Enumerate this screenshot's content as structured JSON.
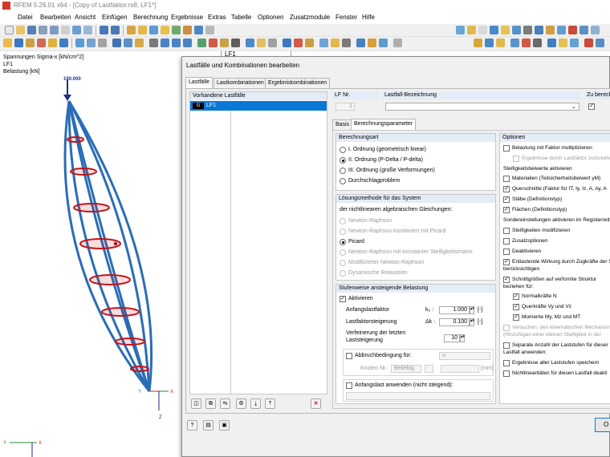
{
  "titlebar": {
    "text": "RFEM 5.26.01 x64 - [Copy of Lastfaktor.rs8, LF1*]"
  },
  "menu": [
    "Datei",
    "Bearbeiten",
    "Ansicht",
    "Einfügen",
    "Berechnung",
    "Ergebnisse",
    "Extras",
    "Tabelle",
    "Optionen",
    "Zusatzmodule",
    "Fenster",
    "Hilfe"
  ],
  "toolbar": {
    "load_case_combo": "LF1"
  },
  "workspace": {
    "info_lines": [
      "Spannungen Sigma-x [kN/cm^2]",
      "LF1",
      "Belastung [kN]"
    ],
    "load_value": "100.000",
    "axis_y": "Y",
    "axis_x": "X",
    "axis_z": "Z"
  },
  "dialog": {
    "title": "Lastfälle und Kombinationen bearbeiten",
    "tabs": [
      "Lastfälle",
      "Lastkombinationen",
      "Ergebniskombinationen"
    ],
    "list_header": "Vorhandene Lastfälle",
    "list_item_code": "G",
    "list_item": "LF1",
    "lf_nr_label": "LF Nr.",
    "lf_nr_value": "1",
    "lf_name_label": "Lastfall-Bezeichnung",
    "lf_name_value": "",
    "zu_label": "Zu berech",
    "subtabs": [
      "Basis",
      "Berechnungsparameter"
    ],
    "berechnungsart": {
      "header": "Berechnungsart",
      "options": [
        "I. Ordnung (geometrisch linear)",
        "II. Ordnung (P-Delta / P-delta)",
        "III. Ordnung (große Verformungen)",
        "Durchschlagproblem"
      ],
      "selected": 1
    },
    "loesung": {
      "header": "Lösungsmethode für das System",
      "subtitle": "der nichtlinearen algebraischen Gleichungen:",
      "options": [
        "Newton-Raphson",
        "Newton-Raphson kombiniert mit Picard",
        "Picard",
        "Newton-Raphson mit konstanter Steifigkeitsmatrix",
        "Modifizierter Newton-Raphson",
        "Dynamische Relaxation"
      ],
      "selected": 2
    },
    "stufen": {
      "header": "Stufenweise ansteigende Belastung",
      "aktivieren": "Aktivieren",
      "anfang_label": "Anfangslastfaktor",
      "anfang_sym": "k₀ :",
      "anfang_value": "1.000",
      "anfang_unit": "[-]",
      "steig_label": "Lastfaktorsteigerung",
      "steig_sym": "Δk :",
      "steig_value": "0.100",
      "steig_unit": "[-]",
      "verf_label_1": "Verfeinerung der letzten",
      "verf_label_2": "Laststeigerung",
      "verf_value": "10",
      "abbruch_label": "Abbruchbedingung für:",
      "abbruch_value": "u",
      "knoten_label": "Knoten Nr.:",
      "knoten_value": "Beliebig",
      "mm_unit": "[mm]",
      "anfangslast_label": "Anfangslast anwenden (nicht steigend):"
    },
    "optionen": {
      "header": "Optionen",
      "lines": [
        {
          "text": "Belastung mit Faktor multiplizieren:",
          "check": "off",
          "indent": 0
        },
        {
          "text": "Ergebnisse durch Lastfaktor zurückdividi",
          "check": "dis",
          "indent": 1
        },
        {
          "text": "Steifigkeitsbeiwerte aktivieren",
          "check": "none",
          "indent": 0
        },
        {
          "text": "Materialien (Teilsicherheitsbeiwert γM)",
          "check": "off",
          "indent": 0
        },
        {
          "text": "Querschnitte (Faktor für IT, Iy, Iz, A, Ay, A",
          "check": "on",
          "indent": 0
        },
        {
          "text": "Stäbe (Definitionstyp)",
          "check": "on",
          "indent": 0
        },
        {
          "text": "Flächen (Definitionstyp)",
          "check": "on",
          "indent": 0
        },
        {
          "text": "Sondereinstellungen aktivieren im Registerreit",
          "check": "none",
          "indent": 0
        },
        {
          "text": "Steifigkeiten modifizieren",
          "check": "off",
          "indent": 0
        },
        {
          "text": "Zusatzoptionen",
          "check": "off",
          "indent": 0
        },
        {
          "text": "Deaktivieren",
          "check": "off",
          "indent": 0
        },
        {
          "text": "Entlastende Wirkung durch Zugkräfte der S",
          "check": "on",
          "indent": 0
        },
        {
          "text": "berücksichtigen",
          "check": "none",
          "indent": 0
        },
        {
          "text": "Schnittgrößen auf verformte Struktur",
          "check": "on",
          "indent": 0
        },
        {
          "text": "beziehen für:",
          "check": "none",
          "indent": 0
        },
        {
          "text": "Normalkräfte N",
          "check": "on",
          "indent": 1
        },
        {
          "text": "Querkräfte Vy und Vz",
          "check": "on",
          "indent": 1
        },
        {
          "text": "Momente My, Mz und MT",
          "check": "on",
          "indent": 1
        },
        {
          "text": "Versuchen, den kinematischen Mechanismu",
          "check": "dis",
          "indent": 0
        },
        {
          "text": "(Hinzufügen einer kleinen Steifigkeit in der",
          "check": "dis-none",
          "indent": 0
        },
        {
          "text": "Separate Anzahl der Laststufen für dieser",
          "check": "off",
          "indent": 0
        },
        {
          "text": "Lastfall anwenden:",
          "check": "none",
          "indent": 0
        },
        {
          "text": "Ergebnisse aller Laststufen speichern",
          "check": "off",
          "indent": 0
        },
        {
          "text": "Nichtlinearitäten für diesen Lastfall deakti",
          "check": "off",
          "indent": 0
        }
      ]
    },
    "ok_label": "O"
  },
  "colors": {
    "dialog_bg": "#f0f0f0",
    "section_header": "#e3ecf7",
    "selection": "#0a78d7",
    "arrow": "#e03c31",
    "member": "#1f6fb0",
    "ring": "#c0161c"
  }
}
